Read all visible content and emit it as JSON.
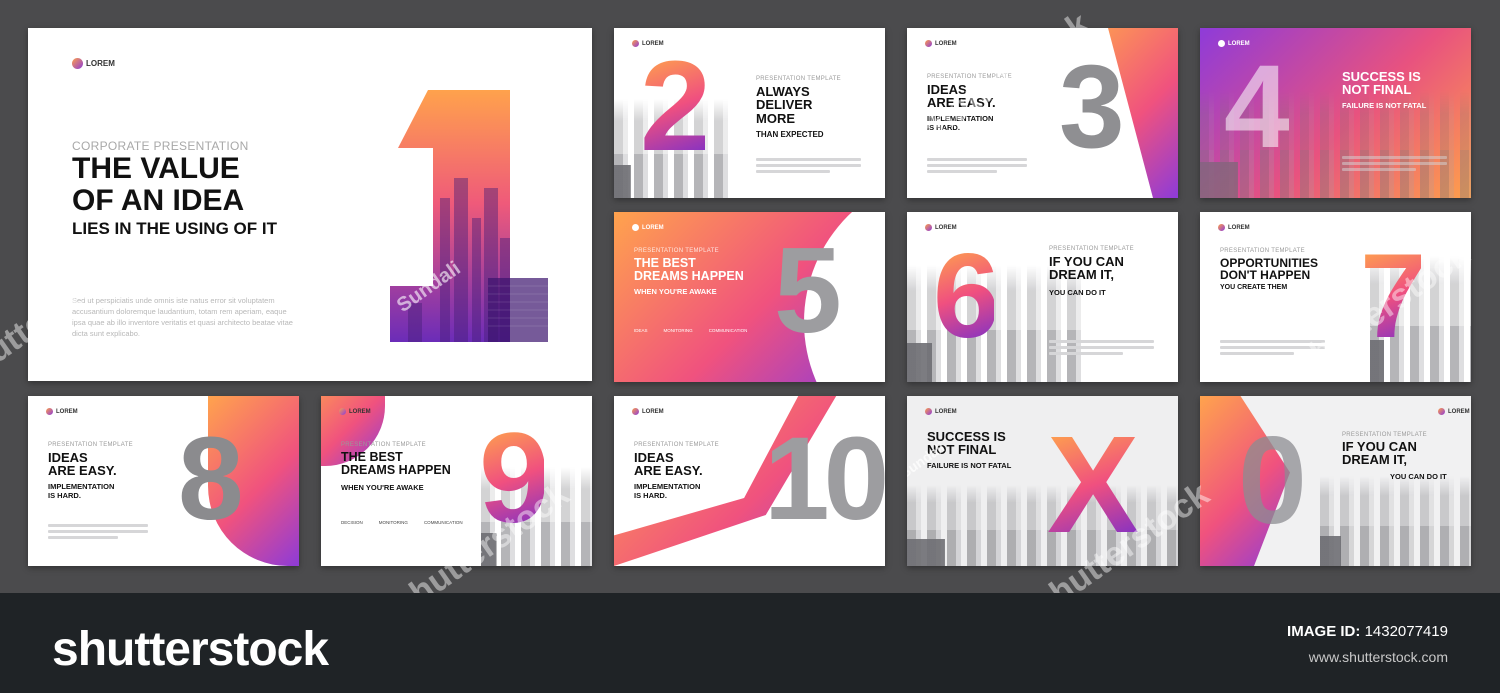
{
  "slide1": {
    "logo": "LOREM",
    "kicker": "CORPORATE PRESENTATION",
    "title_line1": "THE VALUE",
    "title_line2": "OF AN IDEA",
    "subtitle": "LIES IN THE USING OF IT",
    "number": "1",
    "body": "Sed ut perspiciatis unde omnis iste natus error sit voluptatem accusantium doloremque laudantium, totam rem aperiam, eaque ipsa quae ab illo inventore veritatis et quasi architecto beatae vitae dicta sunt explicabo.",
    "watermark": "Sundali"
  },
  "slide2": {
    "logo": "LOREM",
    "number": "2",
    "kicker": "PRESENTATION TEMPLATE",
    "head": "ALWAYS\nDELIVER\nMORE",
    "sub": "THAN EXPECTED"
  },
  "slide3": {
    "logo": "LOREM",
    "number": "3",
    "kicker": "PRESENTATION TEMPLATE",
    "head": "IDEAS\nARE EASY.",
    "sub": "IMPLEMENTATION\nIS HARD."
  },
  "slide4": {
    "logo": "LOREM",
    "number": "4",
    "head": "SUCCESS IS\nNOT FINAL",
    "sub": "FAILURE IS NOT FATAL"
  },
  "slide5": {
    "logo": "LOREM",
    "number": "5",
    "kicker": "PRESENTATION TEMPLATE",
    "head": "THE BEST\nDREAMS HAPPEN",
    "sub": "WHEN YOU'RE AWAKE",
    "features": [
      "IDEAS",
      "MONITORING",
      "COMMUNICATION"
    ]
  },
  "slide6": {
    "logo": "LOREM",
    "number": "6",
    "kicker": "PRESENTATION TEMPLATE",
    "head": "IF YOU CAN\nDREAM IT,",
    "sub": "YOU CAN DO IT"
  },
  "slide7": {
    "logo": "LOREM",
    "number": "7",
    "kicker": "PRESENTATION TEMPLATE",
    "head": "OPPORTUNITIES\nDON'T HAPPEN",
    "sub": "YOU CREATE THEM"
  },
  "slide8": {
    "logo": "LOREM",
    "number": "8",
    "kicker": "PRESENTATION TEMPLATE",
    "head": "IDEAS\nARE EASY.",
    "sub": "IMPLEMENTATION\nIS HARD."
  },
  "slide9": {
    "logo": "LOREM",
    "number": "9",
    "kicker": "PRESENTATION TEMPLATE",
    "head": "THE BEST\nDREAMS HAPPEN",
    "sub": "WHEN YOU'RE AWAKE",
    "features": [
      "DECISION",
      "MONITORING",
      "COMMUNICATION"
    ]
  },
  "slide10": {
    "logo": "LOREM",
    "number": "10",
    "kicker": "PRESENTATION TEMPLATE",
    "head": "IDEAS\nARE EASY.",
    "sub": "IMPLEMENTATION\nIS HARD."
  },
  "slide11": {
    "logo": "LOREM",
    "number": "X",
    "head": "SUCCESS IS\nNOT FINAL",
    "sub": "FAILURE IS NOT FATAL",
    "watermark": "Sundali"
  },
  "slide12": {
    "logo": "LOREM",
    "number": "0",
    "kicker": "PRESENTATION TEMPLATE",
    "head": "IF YOU CAN\nDREAM IT,",
    "sub": "YOU CAN DO IT"
  },
  "footer": {
    "brand": "shutterstock",
    "image_id_label": "IMAGE ID:",
    "image_id": "1432077419",
    "url": "www.shutterstock.com"
  },
  "watermark_text": "shutterstock",
  "colors": {
    "orange": "#ffa34d",
    "pink": "#f0527e",
    "purple": "#8d3bd8",
    "footer_bg": "#1f2326",
    "stage_bg": "#4b4b4d"
  }
}
